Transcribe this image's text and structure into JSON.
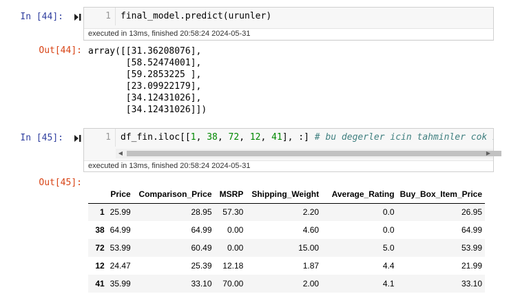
{
  "cell44": {
    "in_prompt": "In [44]:",
    "line_number": "1",
    "code": "final_model.predict(urunler)",
    "exec_info": "executed in 13ms, finished 20:58:24 2024-05-31",
    "out_prompt": "Out[44]:",
    "output_lines": [
      "array([[31.36208076],",
      "       [58.52474001],",
      "       [59.2853225 ],",
      "       [23.09922179],",
      "       [34.12431026],",
      "       [34.12431026]])"
    ]
  },
  "cell45": {
    "in_prompt": "In [45]:",
    "line_number": "1",
    "code_prefix": "df_fin.iloc[[",
    "code_nums": [
      "1",
      "38",
      "72",
      "12",
      "41"
    ],
    "code_middle": "], :] ",
    "code_comment": "# bu degerler icin tahminler cok iyi",
    "exec_info": "executed in 13ms, finished 20:58:24 2024-05-31",
    "out_prompt": "Out[45]:",
    "table": {
      "columns": [
        "",
        "Price",
        "Comparison_Price",
        "MSRP",
        "Shipping_Weight",
        "Average_Rating",
        "Buy_Box_Item_Price"
      ],
      "rows": [
        [
          "1",
          "25.99",
          "28.95",
          "57.30",
          "2.20",
          "0.0",
          "26.95"
        ],
        [
          "38",
          "64.99",
          "64.99",
          "0.00",
          "4.60",
          "0.0",
          "64.99"
        ],
        [
          "72",
          "53.99",
          "60.49",
          "0.00",
          "15.00",
          "5.0",
          "53.99"
        ],
        [
          "12",
          "24.47",
          "25.39",
          "12.18",
          "1.87",
          "4.4",
          "21.99"
        ],
        [
          "41",
          "35.99",
          "33.10",
          "70.00",
          "2.00",
          "4.1",
          "33.10"
        ]
      ]
    }
  },
  "colors": {
    "in_prompt": "#303f9f",
    "out_prompt": "#d84315",
    "number": "#008800",
    "comment": "#408080"
  }
}
